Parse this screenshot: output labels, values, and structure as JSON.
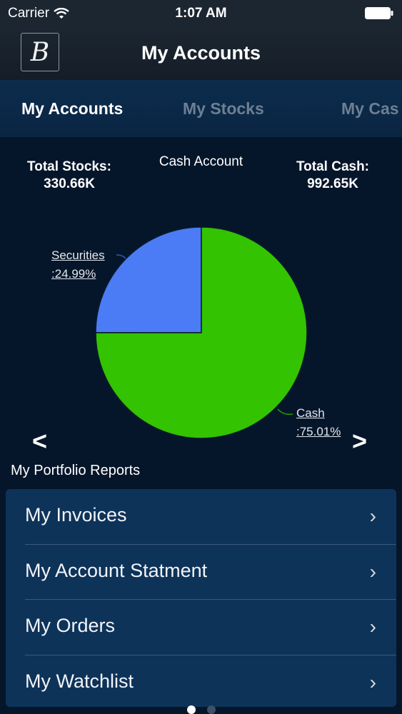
{
  "status_bar": {
    "carrier": "Carrier",
    "time": "1:07 AM"
  },
  "header": {
    "logo_letter": "B",
    "title": "My Accounts"
  },
  "tabs": [
    {
      "label": "My Accounts",
      "active": true
    },
    {
      "label": "My Stocks",
      "active": false
    },
    {
      "label": "My Cas",
      "active": false
    }
  ],
  "summary": {
    "stocks_label": "Total Stocks:",
    "stocks_value": "330.66K",
    "chart_title": "Cash Account",
    "cash_label": "Total Cash:",
    "cash_value": "992.65K"
  },
  "chart_data": {
    "type": "pie",
    "title": "Cash Account",
    "slices": [
      {
        "label": "Cash",
        "value_label": ":75.01%",
        "value": 75.01,
        "color": "#33c300"
      },
      {
        "label": "Securities",
        "value_label": ":24.99%",
        "value": 24.99,
        "color": "#4b7cf5"
      }
    ]
  },
  "carousel": {
    "prev": "<",
    "next": ">"
  },
  "reports": {
    "title": "My Portfolio Reports",
    "items": [
      {
        "label": "My Invoices"
      },
      {
        "label": "My Account Statment"
      },
      {
        "label": "My Orders"
      },
      {
        "label": "My Watchlist"
      }
    ]
  },
  "colors": {
    "background": "#06162a",
    "list_bg": "#0e3359",
    "tab_bg": "#0c2c4d"
  }
}
